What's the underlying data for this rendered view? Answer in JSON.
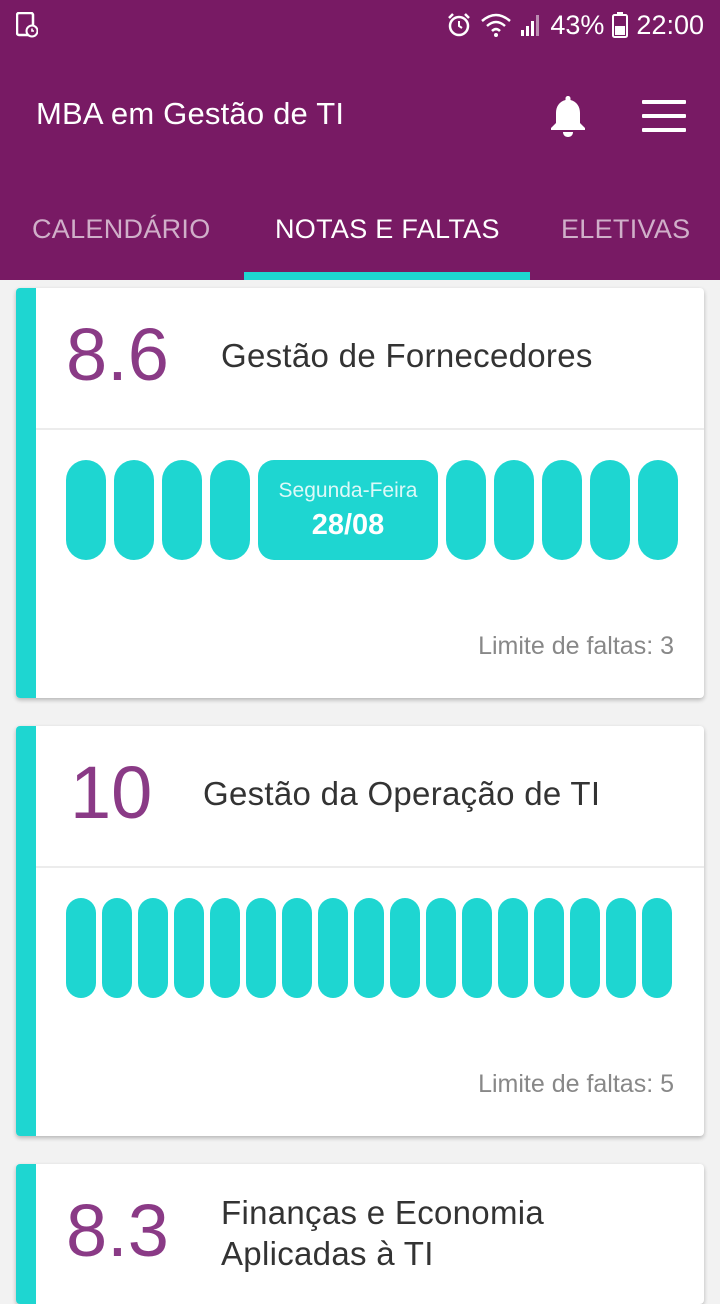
{
  "status_bar": {
    "battery": "43%",
    "time": "22:00"
  },
  "header": {
    "title": "MBA em Gestão de TI"
  },
  "tabs": [
    {
      "label": "CALENDÁRIO",
      "active": false
    },
    {
      "label": "NOTAS E FALTAS",
      "active": true
    },
    {
      "label": "ELETIVAS",
      "active": false
    }
  ],
  "cards": [
    {
      "grade": "8.6",
      "subject": "Gestão de Fornecedores",
      "highlight_day": "Segunda-Feira",
      "highlight_date": "28/08",
      "limit_label": "Limite de faltas: 3"
    },
    {
      "grade": "10",
      "subject": "Gestão da Operação de TI",
      "limit_label": "Limite de faltas: 5"
    },
    {
      "grade": "8.3",
      "subject_line1": "Finanças e Economia",
      "subject_line2": "Aplicadas à TI"
    }
  ],
  "colors": {
    "primary": "#781A64",
    "accent": "#1ED6D1",
    "grade": "#8A3A86"
  }
}
